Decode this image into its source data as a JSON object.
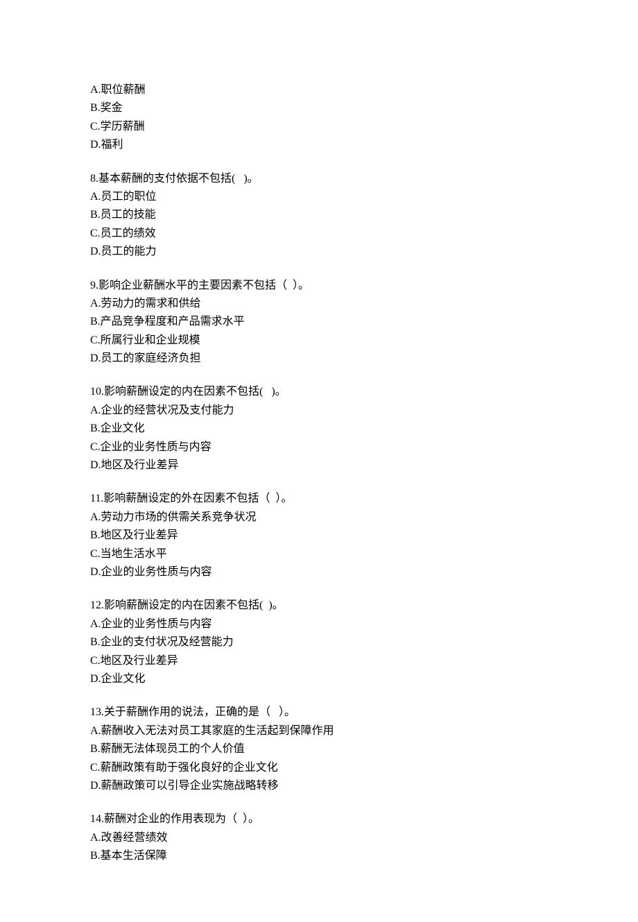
{
  "blocks": [
    {
      "lines": [
        "A.职位薪酬",
        "B.奖金",
        "C.学历薪酬",
        "D.福利"
      ]
    },
    {
      "lines": [
        "8.基本薪酬的支付依据不包括(   )。",
        "A.员工的职位",
        "B.员工的技能",
        "C.员工的绩效",
        "D.员工的能力"
      ]
    },
    {
      "lines": [
        "9.影响企业薪酬水平的主要因素不包括（  ）。",
        "A.劳动力的需求和供给",
        "B.产品竞争程度和产品需求水平",
        "C.所属行业和企业规模",
        "D.员工的家庭经济负担"
      ]
    },
    {
      "lines": [
        "10.影响薪酬设定的内在因素不包括(   )。",
        "A.企业的经营状况及支付能力",
        "B.企业文化",
        "C.企业的业务性质与内容",
        "D.地区及行业差异"
      ]
    },
    {
      "lines": [
        "11.影响薪酬设定的外在因素不包括（  ）。",
        "A.劳动力市场的供需关系竞争状况",
        "B.地区及行业差异",
        "C.当地生活水平",
        "D.企业的业务性质与内容"
      ]
    },
    {
      "lines": [
        "12.影响薪酬设定的内在因素不包括(  )。",
        "A.企业的业务性质与内容",
        "B.企业的支付状况及经营能力",
        "C.地区及行业差异",
        "D.企业文化"
      ]
    },
    {
      "lines": [
        "13.关于薪酬作用的说法，正确的是（   ）。",
        "A.薪酬收入无法对员工其家庭的生活起到保障作用",
        "B.薪酬无法体现员工的个人价值",
        "C.薪酬政策有助于强化良好的企业文化",
        "D.薪酬政策可以引导企业实施战略转移"
      ]
    },
    {
      "lines": [
        "14.薪酬对企业的作用表现为（  ）。",
        "A.改善经营绩效",
        "B.基本生活保障"
      ]
    }
  ]
}
